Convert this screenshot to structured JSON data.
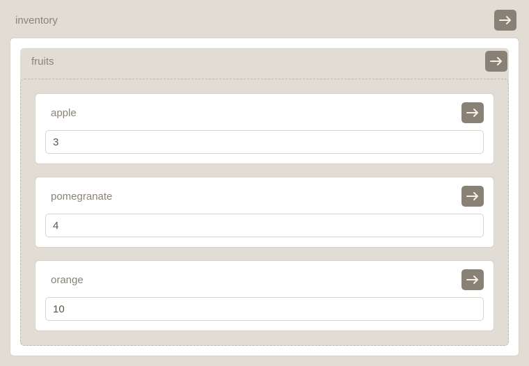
{
  "root": {
    "title": "inventory"
  },
  "section": {
    "title": "fruits"
  },
  "items": [
    {
      "name": "apple",
      "value": "3"
    },
    {
      "name": "pomegranate",
      "value": "4"
    },
    {
      "name": "orange",
      "value": "10"
    }
  ]
}
